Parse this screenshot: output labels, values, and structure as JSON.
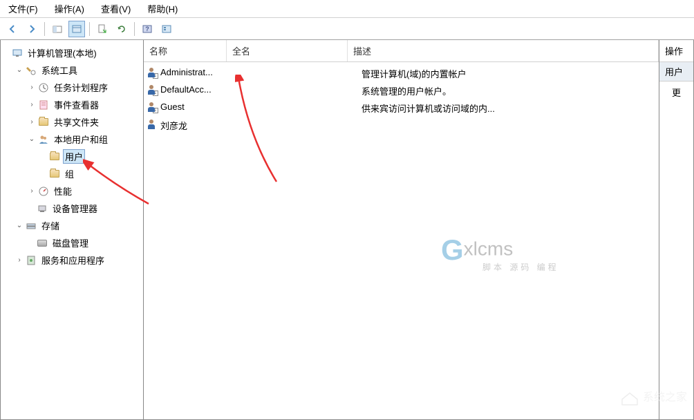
{
  "menu": {
    "file": "文件(F)",
    "action": "操作(A)",
    "view": "查看(V)",
    "help": "帮助(H)"
  },
  "tree": {
    "root": "计算机管理(本地)",
    "system_tools": "系统工具",
    "task_scheduler": "任务计划程序",
    "event_viewer": "事件查看器",
    "shared_folders": "共享文件夹",
    "local_users_groups": "本地用户和组",
    "users": "用户",
    "groups": "组",
    "performance": "性能",
    "device_manager": "设备管理器",
    "storage": "存储",
    "disk_management": "磁盘管理",
    "services_apps": "服务和应用程序"
  },
  "list": {
    "header_name": "名称",
    "header_fullname": "全名",
    "header_desc": "描述",
    "rows": [
      {
        "name": "Administrat...",
        "fullname": "",
        "desc": "管理计算机(域)的内置帐户"
      },
      {
        "name": "DefaultAcc...",
        "fullname": "",
        "desc": "系统管理的用户帐户。"
      },
      {
        "name": "Guest",
        "fullname": "",
        "desc": "供来宾访问计算机或访问域的内..."
      },
      {
        "name": "刘彦龙",
        "fullname": "",
        "desc": ""
      }
    ]
  },
  "actions": {
    "header": "操作",
    "section": "用户",
    "more": "更"
  },
  "watermark": {
    "brand": "xlcms",
    "g": "G",
    "sub": "脚本 源码 编程",
    "logo": "系统之家"
  }
}
